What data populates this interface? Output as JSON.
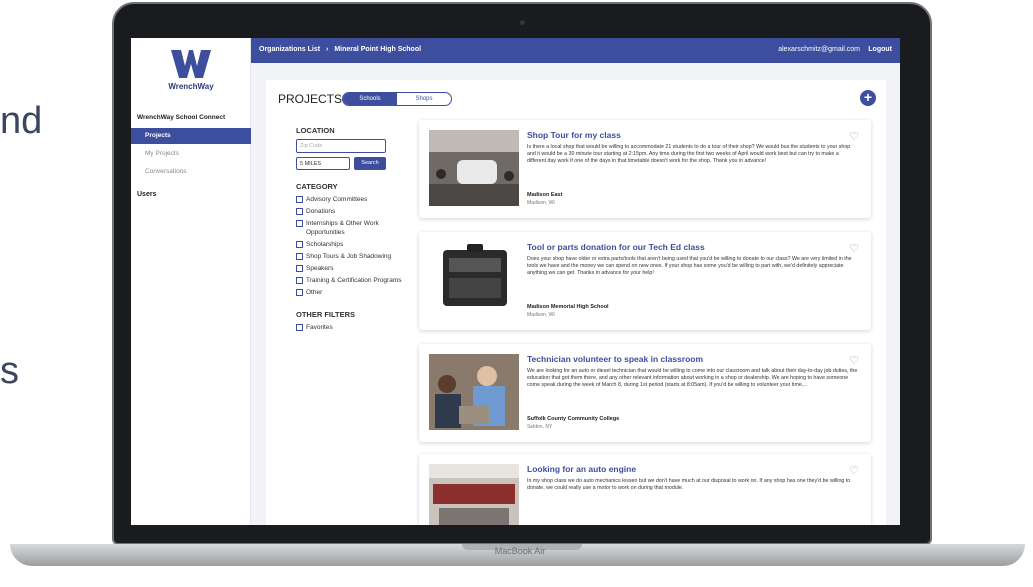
{
  "slide_fragments": [
    "nd",
    "s"
  ],
  "device_label": "MacBook Air",
  "brand": {
    "name": "WrenchWay",
    "accent": "#3e4e9e"
  },
  "sidebar": {
    "section": "WrenchWay School Connect",
    "items": [
      {
        "label": "Projects",
        "active": true
      },
      {
        "label": "My Projects",
        "active": false
      },
      {
        "label": "Conversations",
        "active": false
      }
    ],
    "users_label": "Users"
  },
  "topbar": {
    "crumb_1": "Organizations List",
    "crumb_sep": "›",
    "crumb_2": "Mineral Point High School",
    "email": "alexarschmitz@gmail.com",
    "logout": "Logout"
  },
  "projects": {
    "title": "PROJECTS",
    "tab_schools": "Schools",
    "tab_shops": "Shops",
    "add_icon": "plus-icon"
  },
  "filters": {
    "location_head": "LOCATION",
    "zip_placeholder": "Zip Code",
    "miles_value": "5 MILES",
    "search_label": "Search",
    "category_head": "CATEGORY",
    "categories": [
      "Advisory Committees",
      "Donations",
      "Internships & Other Work Opportunities",
      "Scholarships",
      "Shop Tours & Job Shadowing",
      "Speakers",
      "Training & Certification Programs",
      "Other"
    ],
    "other_head": "OTHER FILTERS",
    "other": [
      "Favorites"
    ]
  },
  "cards": [
    {
      "title": "Shop Tour for my class",
      "body": "Is there a local shop that would be willing to accommodate 21 students to do a tour of their shop? We would bus the students to your shop and it would be a 30 minute tour starting at 2:15pm. Any time during the first two weeks of April would work best but can try to make a different day work if one of the days in that timetable doesn't work for the shop. Thank you in advance!",
      "org": "Madison East",
      "location": "Madison, WI"
    },
    {
      "title": "Tool or parts donation for our Tech Ed class",
      "body": "Does your shop have older or extra parts/tools that aren't being used that you'd be willing to donate to our class? We are very limited in the tools we have and the money we can spend on new ones. If your shop has some you'd be willing to part with, we'd definitely appreciate anything we can get. Thanks in advance for your help!",
      "org": "Madison Memorial High School",
      "location": "Madison, WI"
    },
    {
      "title": "Technician volunteer to speak in classroom",
      "body": "We are looking for an auto or diesel technician that would be willing to come into our classroom and talk about their day-to-day job duties, the education that got them there, and any other relevant information about working in a shop or dealership. We are hoping to have someone come speak during the week of March 8, during 1st period (starts at 8:05am). If you'd be willing to volunteer your time,...",
      "org": "Suffolk County Community College",
      "location": "Selden, NY"
    },
    {
      "title": "Looking for an auto engine",
      "body": "In my shop class we do auto mechanics lessen but we don't have much at our disposal to work on. If any shop has one they'd be willing to donate, we could really use a motor to work on during that module.",
      "org": "",
      "location": ""
    }
  ]
}
